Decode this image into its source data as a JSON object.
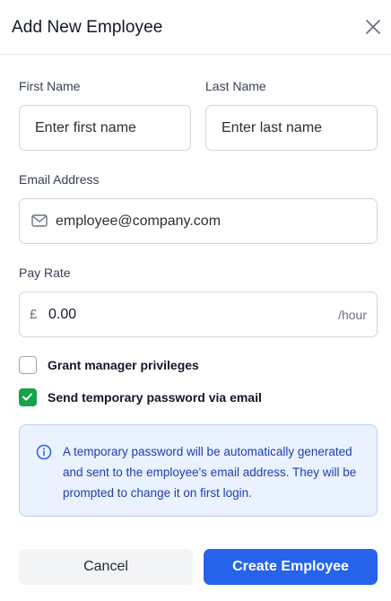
{
  "dialog": {
    "title": "Add New Employee",
    "close_icon": "close-icon"
  },
  "form": {
    "first_name": {
      "label": "First Name",
      "placeholder": "Enter first name",
      "value": ""
    },
    "last_name": {
      "label": "Last Name",
      "placeholder": "Enter last name",
      "value": ""
    },
    "email": {
      "label": "Email Address",
      "placeholder": "employee@company.com",
      "value": "",
      "icon": "mail-icon"
    },
    "pay_rate": {
      "label": "Pay Rate",
      "currency_symbol": "£",
      "value": "0.00",
      "suffix": "/hour"
    },
    "manager_privileges": {
      "label": "Grant manager privileges",
      "checked": false
    },
    "send_password": {
      "label": "Send temporary password via email",
      "checked": true
    }
  },
  "info": {
    "icon": "info-icon",
    "text": "A temporary password will be automatically generated and sent to the employee's email address. They will be prompted to change it on first login."
  },
  "actions": {
    "cancel_label": "Cancel",
    "create_label": "Create Employee"
  },
  "colors": {
    "primary": "#2563eb",
    "checkbox_checked": "#16a34a",
    "info_bg": "#eaf1ff",
    "info_text": "#1e40af"
  }
}
